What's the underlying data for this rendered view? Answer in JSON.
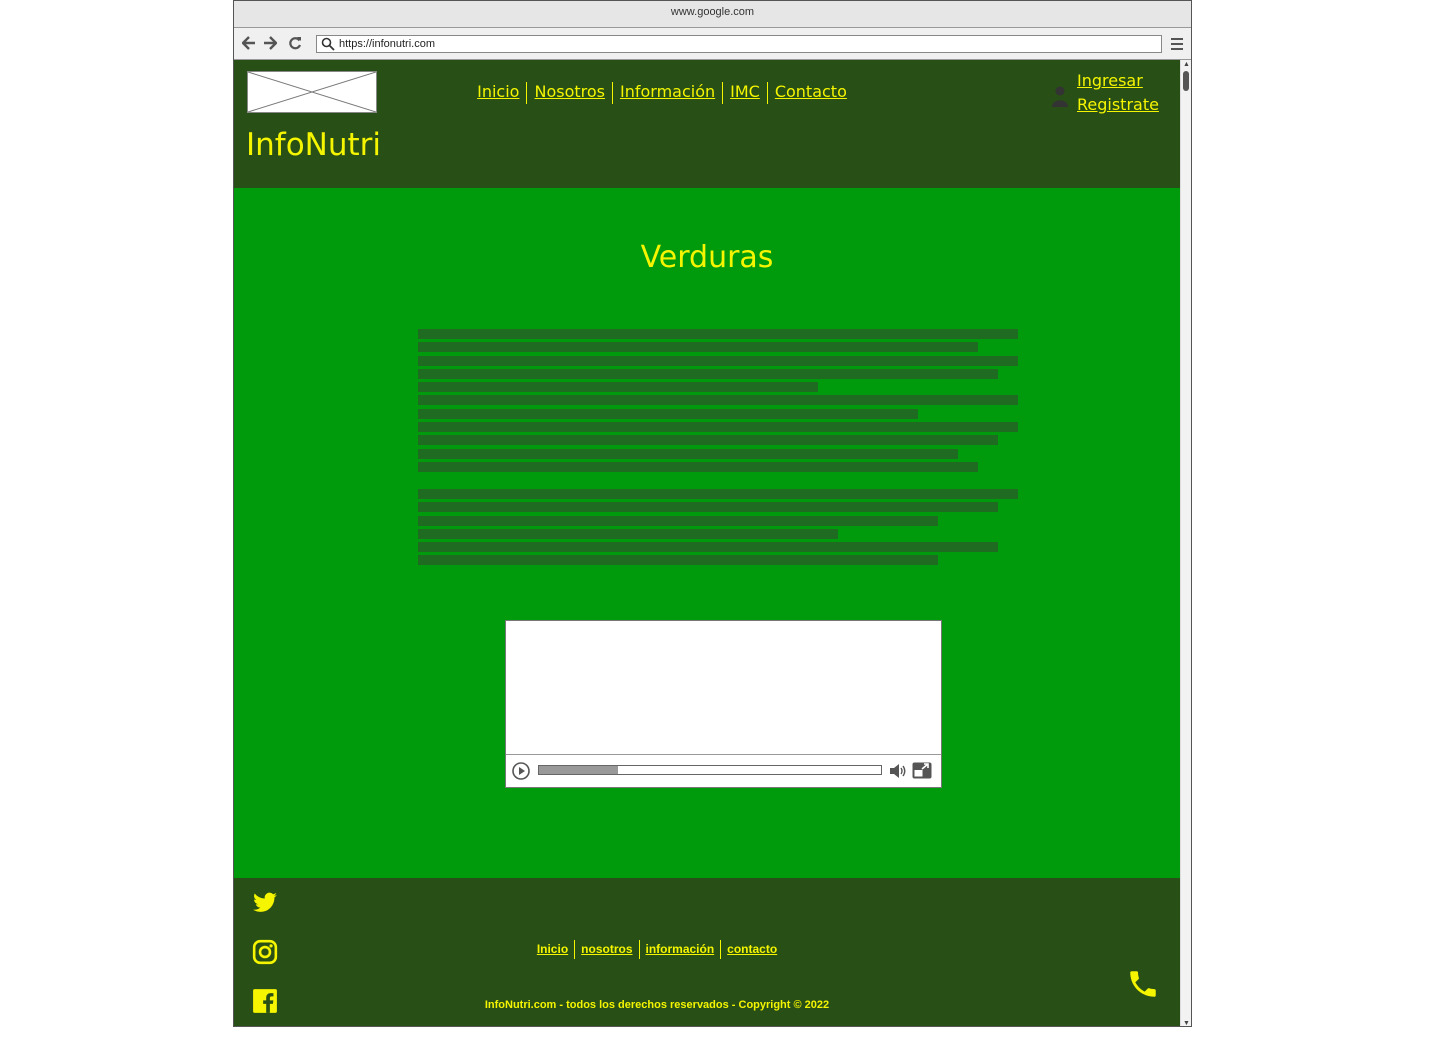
{
  "browser": {
    "window_title": "www.google.com",
    "url": "https://infonutri.com",
    "icons": [
      "back-arrow-icon",
      "forward-arrow-icon",
      "reload-icon",
      "search-icon",
      "hamburger-menu-icon"
    ]
  },
  "header": {
    "brand": "InfoNutri",
    "nav": [
      {
        "label": "Inicio"
      },
      {
        "label": "Nosotros"
      },
      {
        "label": "Información"
      },
      {
        "label": "IMC"
      },
      {
        "label": "Contacto"
      }
    ],
    "login_label": "Ingresar",
    "register_label": "Registrate"
  },
  "main": {
    "title": "Verduras",
    "video": {
      "progress": 0.23,
      "icons": [
        "play-icon",
        "volume-icon",
        "fullscreen-icon"
      ]
    }
  },
  "footer": {
    "nav": [
      {
        "label": "Inicio"
      },
      {
        "label": "nosotros"
      },
      {
        "label": "información"
      },
      {
        "label": "contacto"
      }
    ],
    "copyright": "InfoNutri.com - todos los derechos reservados - Copyright © 2022",
    "social_icons": [
      "twitter-icon",
      "instagram-icon",
      "facebook-icon"
    ],
    "contact_icon": "phone-icon"
  },
  "colors": {
    "header_bg": "#284f15",
    "content_bg": "#009b0d",
    "accent_yellow": "#f5f500",
    "text_placeholder": "#1f6b22"
  }
}
